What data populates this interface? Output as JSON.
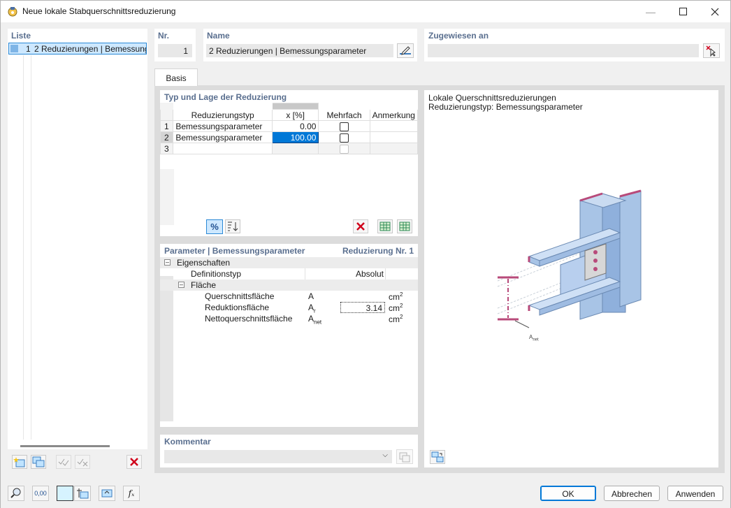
{
  "window": {
    "title": "Neue lokale Stabquerschnittsreduzierung"
  },
  "list": {
    "label": "Liste",
    "items": [
      {
        "num": "1",
        "name": "2 Reduzierungen | Bemessungsparameter"
      }
    ]
  },
  "nr": {
    "label": "Nr.",
    "value": "1"
  },
  "name": {
    "label": "Name",
    "value": "2 Reduzierungen | Bemessungsparameter"
  },
  "assigned": {
    "label": "Zugewiesen an",
    "value": ""
  },
  "tabs": [
    {
      "label": "Basis"
    }
  ],
  "typ": {
    "label": "Typ und Lage der Reduzierung",
    "columns": [
      "Reduzierungstyp",
      "x [%]",
      "Mehrfach",
      "Anmerkung"
    ],
    "rows": [
      {
        "num": "1",
        "type": "Bemessungsparameter",
        "x": "0.00",
        "mehrfach": false
      },
      {
        "num": "2",
        "type": "Bemessungsparameter",
        "x": "100.00",
        "mehrfach": false
      },
      {
        "num": "3",
        "type": "",
        "x": "",
        "mehrfach": false
      }
    ],
    "pct_label": "%"
  },
  "params": {
    "label": "Parameter | Bemessungsparameter",
    "label_right": "Reduzierung Nr. 1",
    "rows": {
      "eigenschaften": "Eigenschaften",
      "definitionstyp": {
        "label": "Definitionstyp",
        "value": "Absolut"
      },
      "flaeche": "Fläche",
      "querschnitt": {
        "label": "Querschnittsfläche",
        "symbol": "A",
        "value": "",
        "unit": "cm"
      },
      "reduktion": {
        "label": "Reduktionsfläche",
        "symbol": "A",
        "sub": "r",
        "value": "3.14",
        "unit": "cm"
      },
      "netto": {
        "label": "Nettoquerschnittsfläche",
        "symbol": "A",
        "sub": "net",
        "value": "",
        "unit": "cm"
      },
      "unit_exp": "2"
    }
  },
  "comment": {
    "label": "Kommentar",
    "value": ""
  },
  "preview": {
    "line1": "Lokale Querschnittsreduzierungen",
    "line2": "Reduzierungstyp: Bemessungsparameter",
    "anet_label": "A",
    "anet_sub": "net"
  },
  "buttons": {
    "ok": "OK",
    "cancel": "Abbrechen",
    "apply": "Anwenden"
  },
  "bottom_value": "0,00"
}
